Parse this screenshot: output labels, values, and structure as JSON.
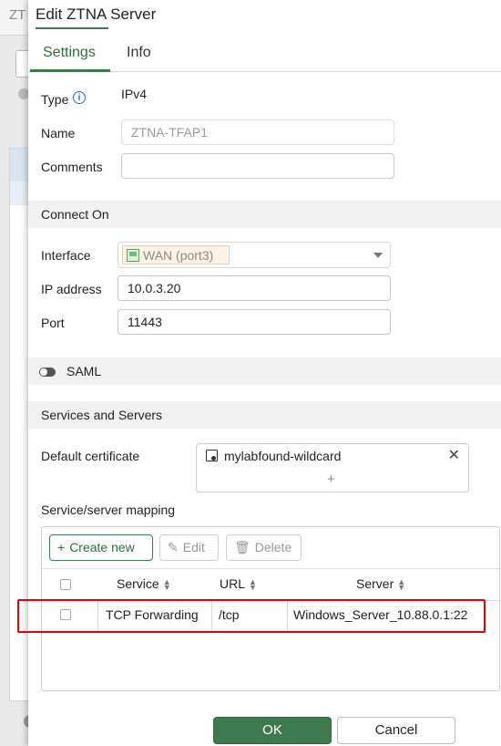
{
  "background": {
    "list_title": "ZT"
  },
  "dialog": {
    "title": "Edit ZTNA Server",
    "tabs": [
      {
        "label": "Settings",
        "active": true
      },
      {
        "label": "Info",
        "active": false
      }
    ]
  },
  "general": {
    "type_label": "Type",
    "type_value": "IPv4",
    "name_label": "Name",
    "name_value": "ZTNA-TFAP1",
    "comments_label": "Comments",
    "comments_value": ""
  },
  "connect_on": {
    "heading": "Connect On",
    "interface_label": "Interface",
    "interface_value": "WAN (port3)",
    "ip_label": "IP address",
    "ip_value": "10.0.3.20",
    "port_label": "Port",
    "port_value": "11443"
  },
  "saml": {
    "label": "SAML",
    "enabled": false
  },
  "services": {
    "heading": "Services and Servers",
    "default_cert_label": "Default certificate",
    "default_cert_value": "mylabfound-wildcard",
    "add_symbol": "+",
    "remove_symbol": "✕",
    "mapping_label": "Service/server mapping",
    "toolbar": {
      "create": "Create new",
      "edit": "Edit",
      "delete": "Delete"
    },
    "columns": [
      "Service",
      "URL",
      "Server"
    ],
    "rows": [
      {
        "service": "TCP Forwarding",
        "url": "/tcp",
        "server": "Windows_Server_10.88.0.1:22"
      }
    ]
  },
  "footer": {
    "ok": "OK",
    "cancel": "Cancel"
  },
  "colors": {
    "accent": "#3c7a4c",
    "highlight": "#e00000",
    "info": "#2a6fc9"
  }
}
